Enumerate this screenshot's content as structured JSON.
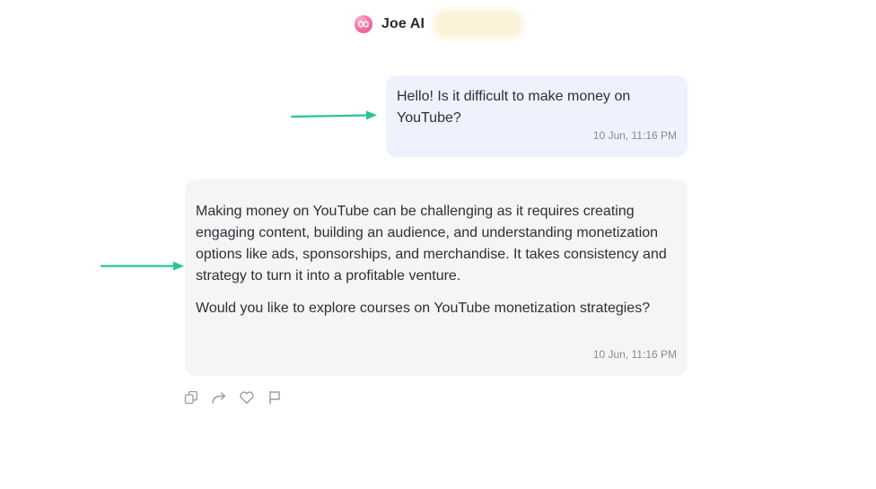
{
  "header": {
    "title": "Joe AI",
    "logo_icon": "infinity-logo-icon",
    "accent": "#f36aa0"
  },
  "messages": [
    {
      "role": "user",
      "text": "Hello! Is it difficult to make money on YouTube?",
      "timestamp": "10 Jun, 11:16 PM"
    },
    {
      "role": "assistant",
      "paragraphs": [
        "Making money on YouTube can be challenging as it requires creating engaging content, building an audience, and understanding monetization options like ads, sponsorships, and merchandise. It takes consistency and strategy to turn it into a profitable venture.",
        "Would you like to explore courses on YouTube monetization strategies?"
      ],
      "timestamp": "10 Jun, 11:16 PM"
    }
  ],
  "actions": [
    {
      "name": "copy-icon"
    },
    {
      "name": "share-icon"
    },
    {
      "name": "heart-icon"
    },
    {
      "name": "flag-icon"
    }
  ],
  "colors": {
    "user_bubble": "#eff1fd",
    "assistant_bubble": "#f5f5f5",
    "annotation_arrow": "#2bc39a"
  }
}
